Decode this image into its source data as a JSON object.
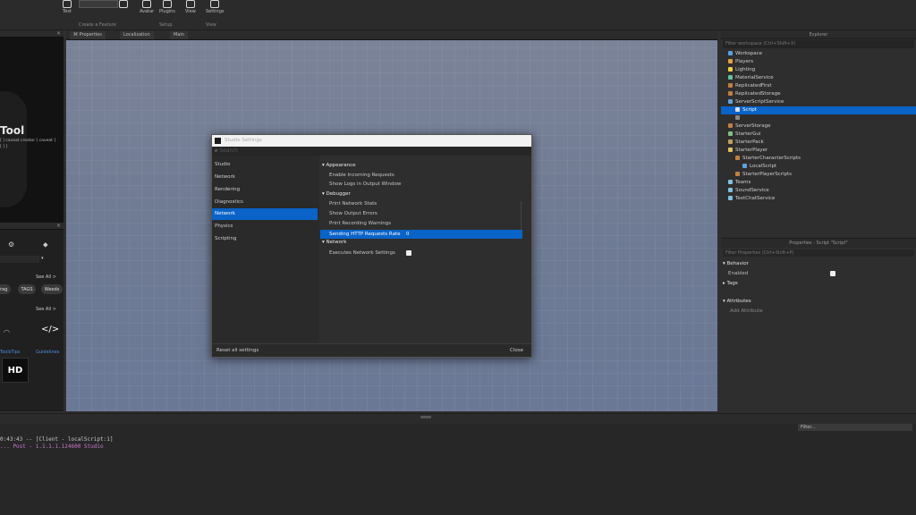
{
  "ribbon": {
    "buttons": [
      "Test",
      "Model",
      "Avatar",
      "Plugins",
      "View",
      "Script",
      "Settings"
    ],
    "groups": [
      "Create a Feature",
      "Collection",
      "Setup",
      "View"
    ]
  },
  "left": {
    "thumb_title": "Tool",
    "thumb_code_1": "[ ] caveat  creator  [ caveat ]",
    "thumb_code_2": "[ ] ]",
    "toolbox_see_all_1": "See All >",
    "toolbox_see_all_2": "See All >",
    "pills": [
      "Frag",
      "TAGS",
      "Weeds"
    ],
    "code_glyph": "</>",
    "link_1": "ToolsTips",
    "link_2": "Guidelines",
    "hd_label": "HD"
  },
  "viewport": {
    "tabs": [
      "Properties",
      "Localization",
      "Main"
    ]
  },
  "explorer": {
    "title": "Explorer",
    "filter_placeholder": "Filter workspace (Ctrl+Shift+X)",
    "rows": [
      {
        "label": "Workspace",
        "color": "#5aa0e0",
        "indent": 8
      },
      {
        "label": "Players",
        "color": "#e0a040",
        "indent": 8
      },
      {
        "label": "Lighting",
        "color": "#f0d040",
        "indent": 8
      },
      {
        "label": "MaterialService",
        "color": "#60c0a0",
        "indent": 8
      },
      {
        "label": "ReplicatedFirst",
        "color": "#c08040",
        "indent": 8
      },
      {
        "label": "ReplicatedStorage",
        "color": "#c08040",
        "indent": 8
      },
      {
        "label": "ServerScriptService",
        "color": "#60a0e0",
        "indent": 8
      },
      {
        "label": "Script",
        "color": "#e0e0e0",
        "indent": 16,
        "selected": true
      },
      {
        "label": "",
        "color": "#888888",
        "indent": 16
      },
      {
        "label": "ServerStorage",
        "color": "#c08040",
        "indent": 8
      },
      {
        "label": "StarterGui",
        "color": "#80c080",
        "indent": 8
      },
      {
        "label": "StarterPack",
        "color": "#c0a060",
        "indent": 8
      },
      {
        "label": "StarterPlayer",
        "color": "#e0c060",
        "indent": 8
      },
      {
        "label": "StarterCharacterScripts",
        "color": "#c08040",
        "indent": 16
      },
      {
        "label": "LocalScript",
        "color": "#60a0e0",
        "indent": 24
      },
      {
        "label": "StarterPlayerScripts",
        "color": "#c08040",
        "indent": 16
      },
      {
        "label": "Teams",
        "color": "#80c0e0",
        "indent": 8
      },
      {
        "label": "SoundService",
        "color": "#80c0e0",
        "indent": 8
      },
      {
        "label": "TextChatService",
        "color": "#80c0e0",
        "indent": 8
      }
    ]
  },
  "properties": {
    "title": "Properties - Script \"Script\"",
    "filter_placeholder": "Filter Properties (Ctrl+Shift+P)",
    "sections": [
      "Behavior",
      "Tags",
      "Attributes"
    ],
    "behavior_row": "Enabled",
    "attributes_row": "Add Attribute"
  },
  "output": {
    "filter_placeholder": "Filter...",
    "lines": [
      {
        "text": "0:43:43  --  [Client - localScript:1]",
        "color": "#c8c8c8"
      },
      {
        "text": "... Post - 1.1.1.1.124600 Studio",
        "color": "#c878d0"
      }
    ]
  },
  "dialog": {
    "title": "Studio Settings",
    "search_placeholder": "Search",
    "nav": [
      "Studio",
      "Network",
      "Rendering",
      "Diagnostics",
      "Physics",
      "Scripting"
    ],
    "nav_selected_label": "Network",
    "sections": [
      "Appearance",
      "Debugger",
      "Network"
    ],
    "settings_appearance": [
      "Enable Incoming Requests",
      "Show Logs in Output Window"
    ],
    "settings_debugger": [
      "Print Network Stats",
      "Show Output Errors",
      "Print Recording Warnings",
      "Sending HTTP Requests Rate"
    ],
    "selected_value": "0",
    "settings_network": [
      "Executes Network Settings"
    ],
    "footer_left": "Reset all settings",
    "footer_right": "Close"
  }
}
